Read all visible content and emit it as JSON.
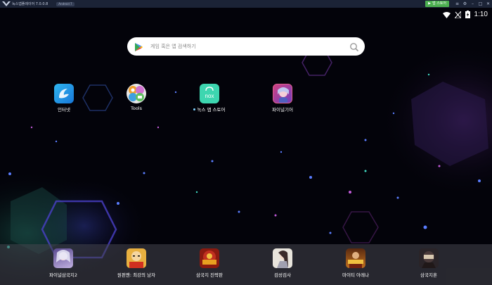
{
  "window": {
    "title": "녹스앱플레이어 7.0.0.8",
    "badge": "Android 7",
    "store_label": "앱 스토어",
    "controls": [
      "menu-icon",
      "settings-icon",
      "minimize-icon",
      "maximize-icon",
      "close-icon"
    ]
  },
  "status_bar": {
    "time": "1:10",
    "icons": [
      "wifi-icon",
      "no-signal-icon",
      "battery-charging-icon"
    ]
  },
  "search": {
    "placeholder": "게임 혹은 앱 검색하기"
  },
  "home_apps": [
    {
      "label": "인터넷",
      "icon": "browser-icon"
    },
    {
      "label": "Tools",
      "icon": "tools-folder-icon"
    },
    {
      "label": "녹스 앱 스토어",
      "icon": "nox-app-store-icon",
      "new_dot": true
    },
    {
      "label": "파이널기어",
      "icon": "final-gear-icon"
    }
  ],
  "dock_apps": [
    {
      "label": "파이널삼국지2",
      "icon": "final-three-kingdoms-2-icon"
    },
    {
      "label": "원펀맨: 최강의 남자",
      "icon": "one-punch-man-icon"
    },
    {
      "label": "삼국지 진략판",
      "icon": "three-kingdoms-strategy-icon"
    },
    {
      "label": "검성검사",
      "icon": "sword-saint-icon"
    },
    {
      "label": "마이티 아레나",
      "icon": "mighty-arena-icon"
    },
    {
      "label": "삼국지혼",
      "icon": "three-kingdoms-soul-icon"
    }
  ],
  "colors": {
    "titlebar": "#1b2336",
    "store_button": "#4caf50",
    "screen_bg": "#03030a",
    "accent_hex": "#3b3fb0"
  }
}
